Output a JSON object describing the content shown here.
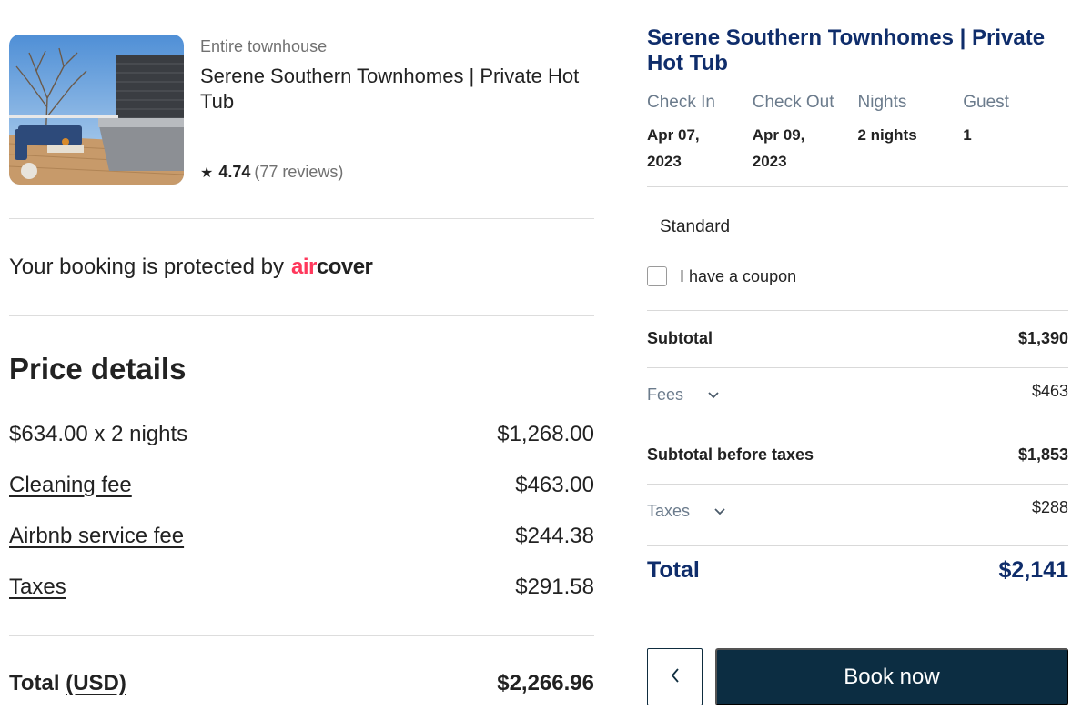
{
  "listing": {
    "property_type": "Entire townhouse",
    "title": "Serene Southern Townhomes | Private Hot Tub",
    "rating": "4.74",
    "reviews": "(77 reviews)"
  },
  "protection": {
    "text": "Your booking is protected by",
    "brand_air": "air",
    "brand_cover": "cover",
    "brand_color": "#ff385c"
  },
  "price_details": {
    "title": "Price details",
    "rows": [
      {
        "label": "$634.00 x 2 nights",
        "value": "$1,268.00"
      },
      {
        "label": "Cleaning fee",
        "value": "$463.00"
      },
      {
        "label": "Airbnb service fee",
        "value": "$244.38"
      },
      {
        "label": "Taxes",
        "value": "$291.58"
      }
    ],
    "total_label": "Total",
    "total_currency": "(USD)",
    "total_value": "$2,266.96"
  },
  "summary": {
    "title": "Serene Southern Townhomes | Private Hot Tub",
    "stay": [
      {
        "header": "Check In",
        "value": "Apr 07, 2023"
      },
      {
        "header": "Check Out",
        "value": "Apr 09, 2023"
      },
      {
        "header": "Nights",
        "value": "2 nights"
      },
      {
        "header": "Guest",
        "value": "1"
      }
    ],
    "rate_name": "Standard",
    "coupon_label": "I have a coupon",
    "subtotal_label": "Subtotal",
    "subtotal_value": "$1,390",
    "fees_label": "Fees",
    "fees_value": "$463",
    "subtotal_before_taxes_label": "Subtotal before taxes",
    "subtotal_before_taxes_value": "$1,853",
    "taxes_label": "Taxes",
    "taxes_value": "$288",
    "total_label": "Total",
    "total_value": "$2,141",
    "book_label": "Book now",
    "accent_color": "#0f2d6b",
    "button_color": "#0c2d42"
  },
  "icons": {
    "rating": "star-icon",
    "back": "chevron-left-icon",
    "expand": "chevron-down-icon"
  }
}
